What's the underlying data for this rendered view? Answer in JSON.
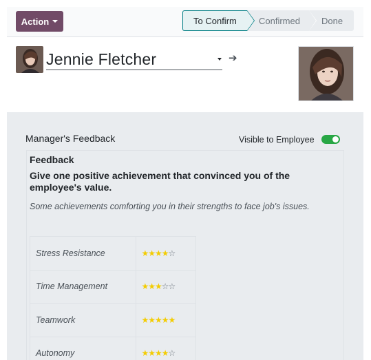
{
  "toolbar": {
    "action_label": "Action"
  },
  "statusbar": {
    "stages": [
      "To Confirm",
      "Confirmed",
      "Done"
    ],
    "active_stage": "To Confirm"
  },
  "employee": {
    "name": "Jennie Fletcher"
  },
  "feedback": {
    "section_title": "Manager's Feedback",
    "visible_label": "Visible to Employee",
    "visible_to_employee": true,
    "heading": "Feedback",
    "question": "Give one positive achievement that convinced you of the employee's value.",
    "hint": "Some achievements comforting you in their strengths to face job's issues.",
    "ratings": [
      {
        "label": "Stress Resistance",
        "stars": 4,
        "max": 5
      },
      {
        "label": "Time Management",
        "stars": 3,
        "max": 5
      },
      {
        "label": "Teamwork",
        "stars": 5,
        "max": 5
      },
      {
        "label": "Autonomy",
        "stars": 4,
        "max": 5
      }
    ]
  },
  "colors": {
    "brand": "#714b67",
    "active_stage": "#017e84",
    "toggle_on": "#28a745",
    "star_on": "#f3cc00"
  }
}
